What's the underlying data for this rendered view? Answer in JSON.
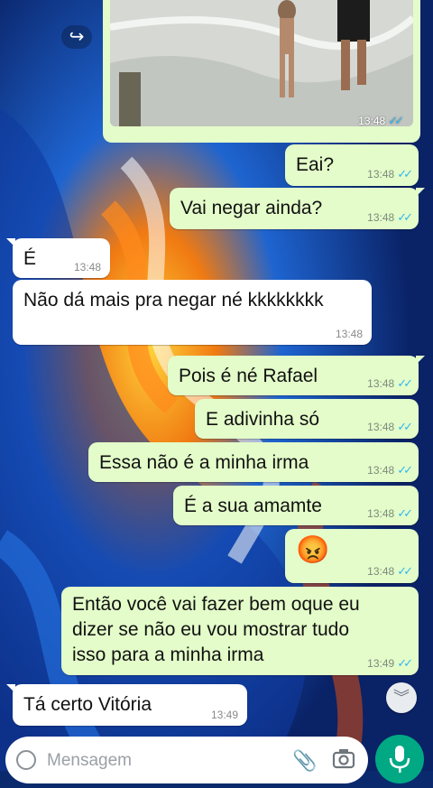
{
  "chat": {
    "image_message": {
      "time": "13:48",
      "status_icon": "double-check-read",
      "forward_icon": "forward-icon"
    },
    "messages": [
      {
        "dir": "out",
        "text": "Eai?",
        "time": "13:48"
      },
      {
        "dir": "out",
        "text": "Vai negar ainda?",
        "time": "13:48"
      },
      {
        "dir": "in",
        "text": "É",
        "time": "13:48"
      },
      {
        "dir": "in",
        "text": "Não dá mais pra negar né kkkkkkkk",
        "time": "13:48"
      },
      {
        "dir": "out",
        "text": "Pois é né Rafael",
        "time": "13:48"
      },
      {
        "dir": "out",
        "text": "E adivinha só",
        "time": "13:48"
      },
      {
        "dir": "out",
        "text": "Essa não é a minha irma",
        "time": "13:48"
      },
      {
        "dir": "out",
        "text": "É a sua amamte",
        "time": "13:48"
      },
      {
        "dir": "out",
        "text": "😡",
        "time": "13:48"
      },
      {
        "dir": "out",
        "lines": [
          "Então você vai fazer bem oque eu",
          "dizer se não eu vou mostrar tudo",
          "isso para a minha irma"
        ],
        "time": "13:49"
      },
      {
        "dir": "in",
        "text": "Tá certo Vitória",
        "time": "13:49"
      }
    ]
  },
  "input": {
    "placeholder": "Mensagem"
  },
  "colors": {
    "outgoing": "#e3fcc9",
    "incoming": "#ffffff",
    "accent": "#00a884",
    "read_ticks": "#34b7f1"
  },
  "icons": [
    "emoji-icon",
    "attach-icon",
    "camera-icon",
    "mic-icon",
    "scroll-down-icon"
  ]
}
